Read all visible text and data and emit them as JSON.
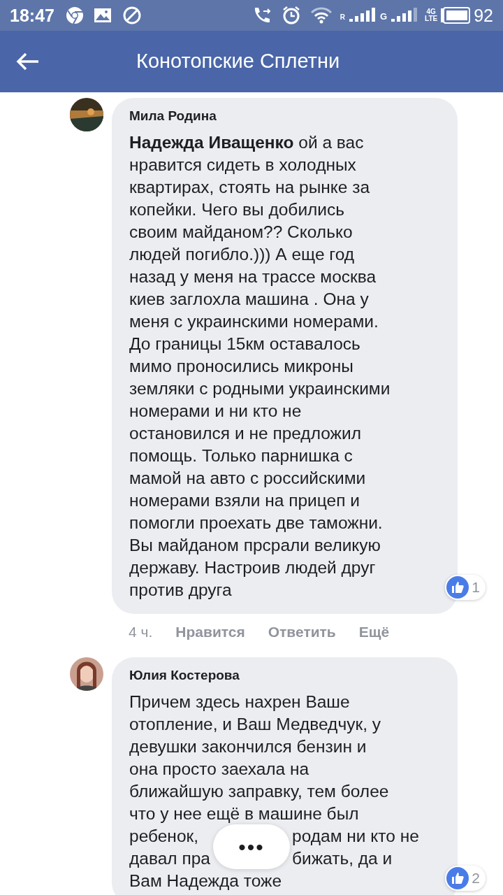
{
  "status_bar": {
    "time": "18:47",
    "sim1_label": "R",
    "sim2_label": "G",
    "network_top": "4G",
    "network_bottom": "LTE",
    "battery": "92"
  },
  "header": {
    "title": "Конотопские Сплетни"
  },
  "comments": [
    {
      "author": "Мила Родина",
      "lines": [
        [
          "**Надежда Иващенко** ой а вас"
        ],
        [
          "нравится сидеть в холодных"
        ],
        [
          "квартирах, стоять на рынке за"
        ],
        [
          "копейки. Чего вы добились"
        ],
        [
          "своим майданом?? Сколько"
        ],
        [
          "людей погибло.))) А еще год"
        ],
        [
          "назад у меня на трассе москва"
        ],
        [
          "киев заглохла машина . Она у"
        ],
        [
          "меня с украинскими номерами."
        ],
        [
          "До границы 15км оставалось"
        ],
        [
          "мимо проносились микроны"
        ],
        [
          "земляки с родными украинскими"
        ],
        [
          "номерами и ни кто не"
        ],
        [
          "остановился и не предложил"
        ],
        [
          "помощь. Только парнишка с"
        ],
        [
          "мамой на авто с российскими"
        ],
        [
          "номерами взяли на прицеп и"
        ],
        [
          "помогли проехать две таможни."
        ],
        [
          "Вы майданом прсрали великую"
        ],
        [
          "державу. Настроив людей друг"
        ],
        [
          "против друга"
        ]
      ],
      "likes": "1",
      "time": "4 ч.",
      "actions": [
        "Нравится",
        "Ответить",
        "Ещё"
      ]
    },
    {
      "author": "Юлия Костерова",
      "lines": [
        [
          "Причем здесь нахрен Ваше"
        ],
        [
          "отопление, и Ваш Медведчук, у"
        ],
        [
          "девушки закончился бензин и"
        ],
        [
          "она просто заехала на"
        ],
        [
          "ближайшую заправку, тем более"
        ],
        [
          "что у нее ещё в машине был"
        ],
        [
          "ребенок,",
          "родам ни кто не"
        ],
        [
          "давал пра",
          "бижать, да и"
        ],
        [
          "Вам Надежда тоже"
        ]
      ],
      "likes": "2"
    }
  ],
  "overlay_button": {
    "label": "•••"
  }
}
